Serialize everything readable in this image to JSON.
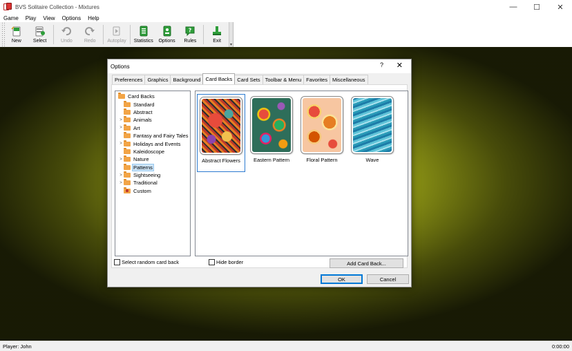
{
  "window": {
    "title": "BVS Solitaire Collection  -  Mixtures",
    "minimize": "—",
    "maximize": "☐",
    "close": "✕"
  },
  "menu": [
    "Game",
    "Play",
    "View",
    "Options",
    "Help"
  ],
  "toolbar": {
    "new": "New",
    "select": "Select",
    "undo": "Undo",
    "redo": "Redo",
    "autoplay": "Autoplay",
    "statistics": "Statistics",
    "options": "Options",
    "rules": "Rules",
    "exit": "Exit"
  },
  "dialog": {
    "title": "Options",
    "help": "?",
    "close": "✕",
    "tabs": [
      "Preferences",
      "Graphics",
      "Background",
      "Card Backs",
      "Card Sets",
      "Toolbar & Menu",
      "Favorites",
      "Miscellaneous"
    ],
    "active_tab": "Card Backs",
    "tree": [
      {
        "label": "Card Backs",
        "level": 0,
        "expander": ""
      },
      {
        "label": "Standard",
        "level": 1,
        "expander": ""
      },
      {
        "label": "Abstract",
        "level": 1,
        "expander": ""
      },
      {
        "label": "Animals",
        "level": 1,
        "expander": ">"
      },
      {
        "label": "Art",
        "level": 1,
        "expander": ">"
      },
      {
        "label": "Fantasy and Fairy Tales",
        "level": 1,
        "expander": ""
      },
      {
        "label": "Holidays and Events",
        "level": 1,
        "expander": ">"
      },
      {
        "label": "Kaleidoscope",
        "level": 1,
        "expander": ""
      },
      {
        "label": "Nature",
        "level": 1,
        "expander": ">"
      },
      {
        "label": "Patterns",
        "level": 1,
        "expander": "",
        "selected": true
      },
      {
        "label": "Sightseeing",
        "level": 1,
        "expander": ">"
      },
      {
        "label": "Traditional",
        "level": 1,
        "expander": ">"
      },
      {
        "label": "Custom",
        "level": 1,
        "expander": "",
        "custom": true
      }
    ],
    "cards": [
      {
        "label": "Abstract Flowers",
        "style": "flowers",
        "selected": true
      },
      {
        "label": "Eastern Pattern",
        "style": "eastern"
      },
      {
        "label": "Floral Pattern",
        "style": "floral"
      },
      {
        "label": "Wave",
        "style": "wave"
      }
    ],
    "select_random": "Select random card back",
    "hide_border": "Hide border",
    "add_card_back": "Add Card Back...",
    "ok": "OK",
    "cancel": "Cancel"
  },
  "status": {
    "player": "Player: John",
    "time": "0:00:00"
  },
  "colors": {
    "felt": "#9aa21c",
    "selection": "#2b7ad0",
    "icon_green": "#2e9e3a"
  }
}
